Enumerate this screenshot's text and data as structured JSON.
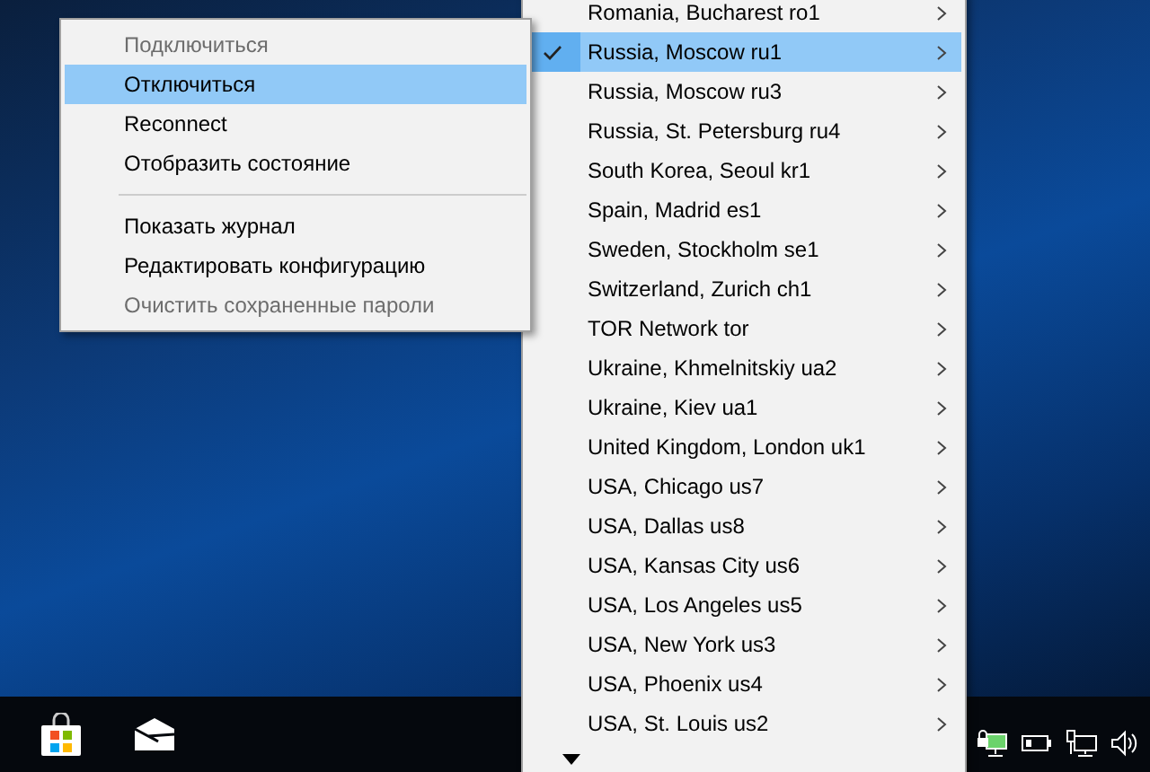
{
  "context_menu": {
    "items": [
      {
        "kind": "item",
        "label": "Подключиться",
        "disabled": true,
        "selected": false
      },
      {
        "kind": "item",
        "label": "Отключиться",
        "disabled": false,
        "selected": true
      },
      {
        "kind": "item",
        "label": "Reconnect",
        "disabled": false,
        "selected": false
      },
      {
        "kind": "item",
        "label": "Отобразить состояние",
        "disabled": false,
        "selected": false
      },
      {
        "kind": "separator"
      },
      {
        "kind": "item",
        "label": "Показать журнал",
        "disabled": false,
        "selected": false
      },
      {
        "kind": "item",
        "label": "Редактировать конфигурацию",
        "disabled": false,
        "selected": false
      },
      {
        "kind": "item",
        "label": "Очистить сохраненные пароли",
        "disabled": true,
        "selected": false
      }
    ]
  },
  "server_menu": {
    "items": [
      {
        "label": "Romania, Bucharest ro1",
        "checked": false,
        "selected": false
      },
      {
        "label": "Russia, Moscow ru1",
        "checked": true,
        "selected": true
      },
      {
        "label": "Russia, Moscow ru3",
        "checked": false,
        "selected": false
      },
      {
        "label": "Russia, St. Petersburg ru4",
        "checked": false,
        "selected": false
      },
      {
        "label": "South Korea, Seoul kr1",
        "checked": false,
        "selected": false
      },
      {
        "label": "Spain, Madrid es1",
        "checked": false,
        "selected": false
      },
      {
        "label": "Sweden, Stockholm se1",
        "checked": false,
        "selected": false
      },
      {
        "label": "Switzerland, Zurich ch1",
        "checked": false,
        "selected": false
      },
      {
        "label": "TOR Network tor",
        "checked": false,
        "selected": false
      },
      {
        "label": "Ukraine, Khmelnitskiy ua2",
        "checked": false,
        "selected": false
      },
      {
        "label": "Ukraine, Kiev ua1",
        "checked": false,
        "selected": false
      },
      {
        "label": "United Kingdom, London uk1",
        "checked": false,
        "selected": false
      },
      {
        "label": "USA, Chicago us7",
        "checked": false,
        "selected": false
      },
      {
        "label": "USA, Dallas us8",
        "checked": false,
        "selected": false
      },
      {
        "label": "USA, Kansas City us6",
        "checked": false,
        "selected": false
      },
      {
        "label": "USA, Los Angeles us5",
        "checked": false,
        "selected": false
      },
      {
        "label": "USA, New York us3",
        "checked": false,
        "selected": false
      },
      {
        "label": "USA, Phoenix us4",
        "checked": false,
        "selected": false
      },
      {
        "label": "USA, St. Louis us2",
        "checked": false,
        "selected": false
      }
    ]
  }
}
